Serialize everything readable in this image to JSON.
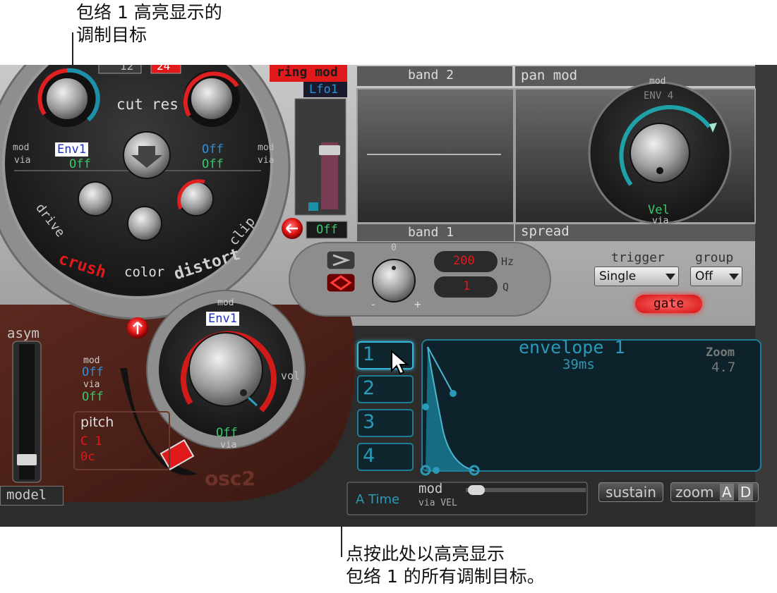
{
  "callouts": {
    "top_line1": "包络 1 高亮显示的",
    "top_line2": "调制目标",
    "bottom_line1": "点按此处以高亮显示",
    "bottom_line2": "包络 1 的所有调制目标。"
  },
  "filter": {
    "slope_left": "12",
    "slope_right": "24",
    "cut_label": "cut",
    "res_label": "res",
    "mod_left": "mod",
    "via_left": "via",
    "mod_left_value": "Env1",
    "via_left_value": "Off",
    "mod_right": "mod",
    "via_right": "via",
    "mod_right_value": "Off",
    "via_right_value": "Off",
    "drive_label": "drive",
    "clip_label": "clip",
    "crush_label": "crush",
    "color_label": "color",
    "distort_label": "distort"
  },
  "ring_mod": {
    "title": "ring mod",
    "source": "Lfo1",
    "value": "Off"
  },
  "eq": {
    "band2_label": "band 2",
    "band1_label": "band 1",
    "knob_zero": "0",
    "minus": "-",
    "plus": "+",
    "freq_value": "200",
    "freq_unit": "Hz",
    "q_value": "1",
    "q_unit": "Q"
  },
  "pan": {
    "pan_mod_label": "pan mod",
    "spread_label": "spread",
    "mod_label": "mod",
    "mod_value": "ENV 4",
    "via_value": "Vel",
    "via_label": "via"
  },
  "trigger": {
    "trigger_label": "trigger",
    "trigger_value": "Single",
    "group_label": "group",
    "group_value": "Off",
    "gate_label": "gate"
  },
  "osc2": {
    "asym_label": "asym",
    "model_label": "model",
    "mod_label": "mod",
    "mod_value": "Off",
    "via_label": "via",
    "via_value": "Off",
    "pitch_label": "pitch",
    "pitch_semitone": "C 1",
    "pitch_cents": "0c",
    "vol_mod_label": "mod",
    "vol_mod_value": "Env1",
    "vol_label": "vol",
    "vol_via_value": "Off",
    "vol_via_label": "via",
    "title": "osc2"
  },
  "envelope": {
    "slots": [
      "1",
      "2",
      "3",
      "4"
    ],
    "title": "envelope 1",
    "time": "39ms",
    "zoom_label": "Zoom",
    "zoom_value": "4.7",
    "a_time_label": "A Time",
    "mod_label": "mod",
    "via_vel_label": "via VEL",
    "sustain_label": "sustain",
    "zoom_button": "zoom",
    "zoom_a": "A",
    "zoom_d": "D"
  },
  "colors": {
    "panel_silver": "#9a9a9a",
    "dark_panel": "#2b2b2b",
    "brown_panel": "#4a2119",
    "envelope_cyan": "#2a9ab8",
    "mod_text_blue": "#1a2fd0",
    "red_led": "#e02020",
    "green_value": "#39c76a"
  }
}
